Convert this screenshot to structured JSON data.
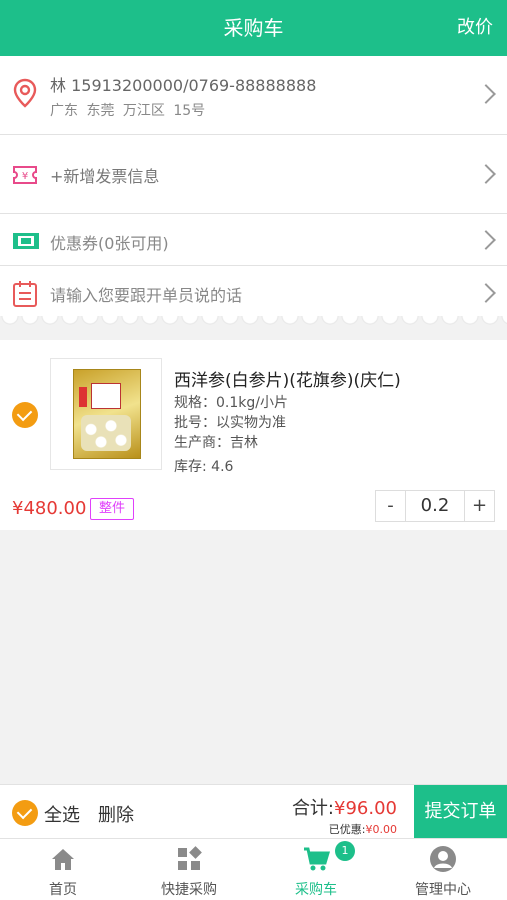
{
  "header": {
    "title": "采购车",
    "action": "改价"
  },
  "address": {
    "line1": "林  15913200000/0769-88888888",
    "line2": "广东 东莞 万江区 15号"
  },
  "invoice": {
    "label": "+新增发票信息"
  },
  "coupon": {
    "label": "优惠券(0张可用)"
  },
  "note": {
    "placeholder": "请输入您要跟开单员说的话"
  },
  "item": {
    "name": "西洋参(白参片)(花旗参)(庆仁)",
    "spec": "规格：0.1kg/小片",
    "batch": "批号：以实物为准",
    "maker": "生产商：吉林",
    "stock": "库存: 4.6",
    "price": "¥480.00",
    "badge": "整件",
    "qty": "0.2",
    "minus": "-",
    "plus": "+"
  },
  "footer": {
    "select_all": "全选",
    "delete": "删除",
    "total_label": "合计:",
    "total_value": "¥96.00",
    "discount_label": "已优惠:",
    "discount_value": "¥0.00",
    "submit": "提交订单"
  },
  "tabs": [
    {
      "label": "首页",
      "icon": "home-icon"
    },
    {
      "label": "快捷采购",
      "icon": "grid-icon"
    },
    {
      "label": "采购车",
      "icon": "cart-icon",
      "badge": "1"
    },
    {
      "label": "管理中心",
      "icon": "user-icon"
    }
  ],
  "colors": {
    "brand": "#1dbf8a",
    "price": "#e53935",
    "check": "#f39c12",
    "badge": "#e040fb"
  }
}
